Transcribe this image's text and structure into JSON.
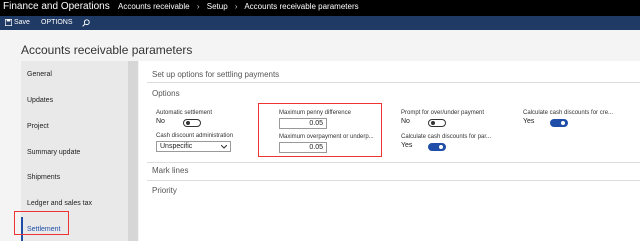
{
  "topbar": {
    "app_title": "Finance and Operations",
    "breadcrumb": [
      "Accounts receivable",
      "Setup",
      "Accounts receivable parameters"
    ]
  },
  "toolbar": {
    "save_label": "Save",
    "options_label": "OPTIONS"
  },
  "page": {
    "title": "Accounts receivable parameters"
  },
  "sidebar": {
    "items": [
      {
        "label": "General"
      },
      {
        "label": "Updates"
      },
      {
        "label": "Project"
      },
      {
        "label": "Summary update"
      },
      {
        "label": "Shipments"
      },
      {
        "label": "Ledger and sales tax"
      },
      {
        "label": "Settlement"
      }
    ],
    "selected": "Settlement"
  },
  "main": {
    "section_title": "Set up options for settling payments",
    "options_header": "Options",
    "fields": {
      "automatic_settlement": {
        "label": "Automatic settlement",
        "value": "No",
        "on": false
      },
      "cash_discount_admin": {
        "label": "Cash discount administration",
        "value": "Unspecific"
      },
      "max_penny_difference": {
        "label": "Maximum penny difference",
        "value": "0.05"
      },
      "max_overpayment": {
        "label": "Maximum overpayment or underp...",
        "value": "0.05"
      },
      "prompt_over_under": {
        "label": "Prompt for over/under payment",
        "value": "No",
        "on": false
      },
      "calc_cash_disc_partial": {
        "label": "Calculate cash discounts for par...",
        "value": "Yes",
        "on": true
      },
      "calc_cash_disc_credit": {
        "label": "Calculate cash discounts for cre...",
        "value": "Yes",
        "on": true
      }
    },
    "mark_lines_header": "Mark lines",
    "priority_header": "Priority"
  },
  "colors": {
    "topbar": "#000000",
    "toolbar": "#1f3a64",
    "accent": "#1f4ea8",
    "highlight": "#e33333"
  }
}
